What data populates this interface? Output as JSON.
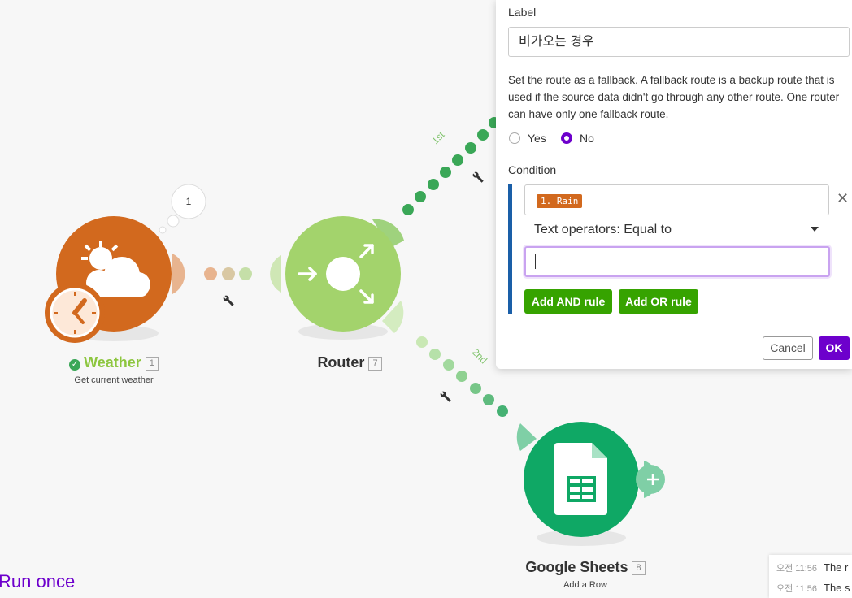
{
  "nodes": {
    "weather": {
      "title": "Weather",
      "id": "1",
      "subtitle": "Get current weather",
      "bubble": "1"
    },
    "router": {
      "title": "Router",
      "id": "7"
    },
    "sheets": {
      "title": "Google Sheets",
      "id": "8",
      "subtitle": "Add a Row"
    }
  },
  "routes": {
    "first": "1st",
    "second": "2nd"
  },
  "run_once": "Run once",
  "panel": {
    "label_caption": "Label",
    "label_value": "비가오는 경우",
    "fallback_help": "Set the route as a fallback. A fallback route is a backup route that is used if the source data didn't go through any other route. One router can have only one fallback route.",
    "yes_label": "Yes",
    "no_label": "No",
    "fallback_selected": "No",
    "condition_caption": "Condition",
    "condition_tag": "1. Rain",
    "operator": "Text operators: Equal to",
    "value": "",
    "add_and": "Add AND rule",
    "add_or": "Add OR rule",
    "cancel": "Cancel",
    "ok": "OK"
  },
  "log": [
    {
      "time": "오전 11:56",
      "text": "The r"
    },
    {
      "time": "오전 11:56",
      "text": "The s"
    }
  ],
  "colors": {
    "weather": "#d2691e",
    "router": "#a3d36c",
    "sheets": "#0fa865",
    "accent": "#6d00cc",
    "route_dots": "#3aa757"
  }
}
